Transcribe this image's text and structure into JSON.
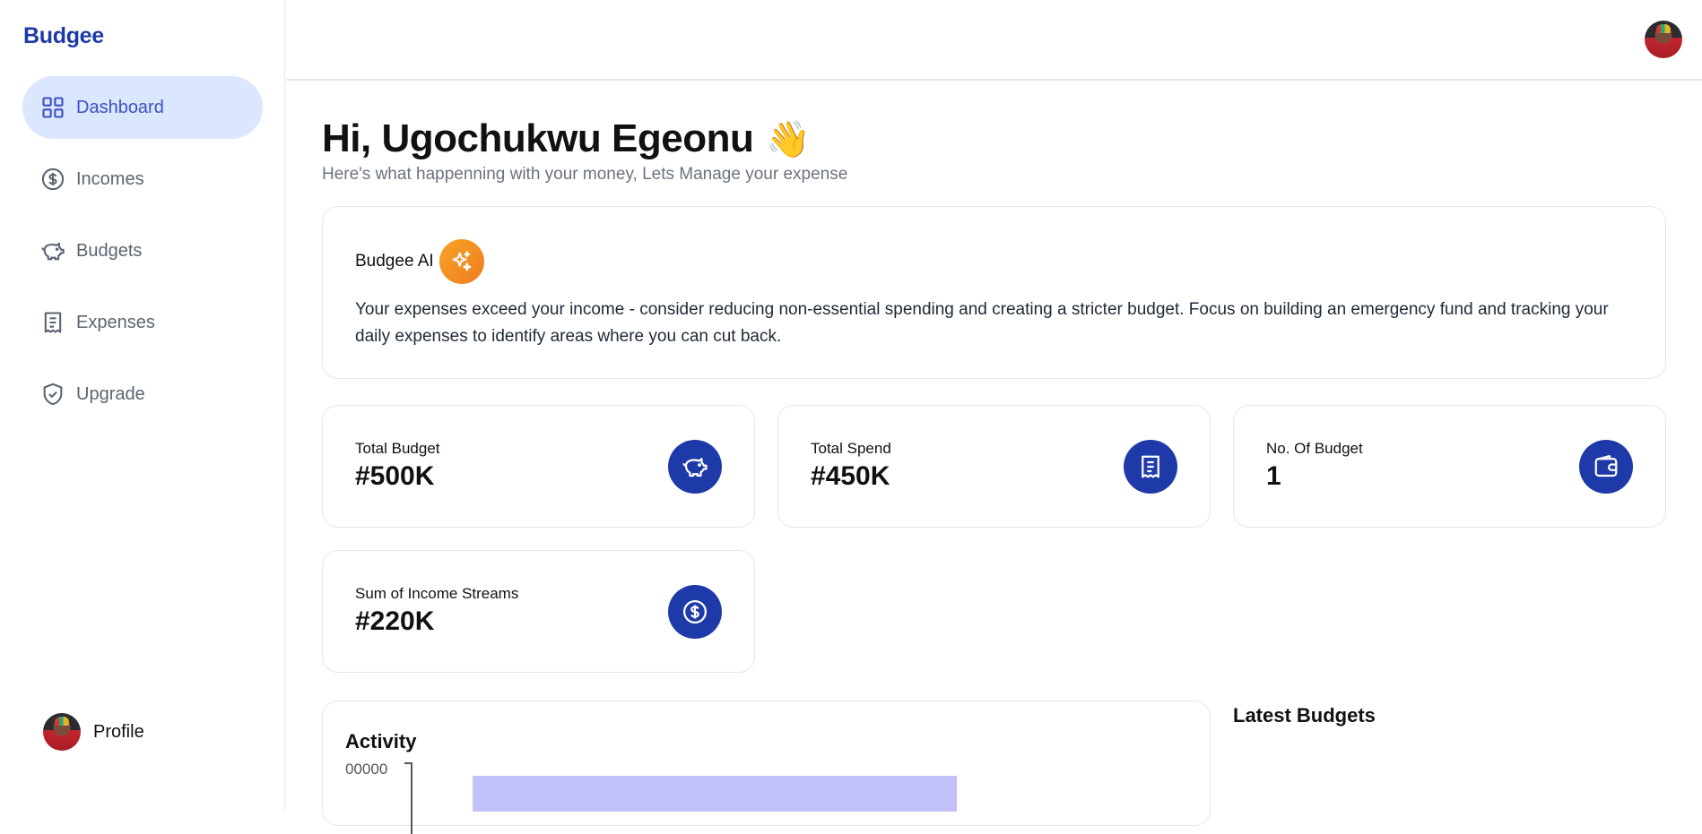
{
  "app": {
    "brand": "Budgee"
  },
  "sidebar": {
    "items": [
      {
        "label": "Dashboard",
        "icon": "grid-icon"
      },
      {
        "label": "Incomes",
        "icon": "dollar-circle-icon"
      },
      {
        "label": "Budgets",
        "icon": "piggy-bank-icon"
      },
      {
        "label": "Expenses",
        "icon": "receipt-icon"
      },
      {
        "label": "Upgrade",
        "icon": "shield-check-icon"
      }
    ],
    "profile_label": "Profile"
  },
  "header": {
    "greeting": "Hi, Ugochukwu Egeonu",
    "wave_emoji": "👋",
    "subtitle": "Here's what happenning with your money, Lets Manage your expense"
  },
  "ai": {
    "title": "Budgee AI",
    "message": "Your expenses exceed your income - consider reducing non-essential spending and creating a stricter budget. Focus on building an emergency fund and tracking your daily expenses to identify areas where you can cut back."
  },
  "stats": [
    {
      "label": "Total Budget",
      "value": "#500K",
      "icon": "piggy-bank-icon"
    },
    {
      "label": "Total Spend",
      "value": "#450K",
      "icon": "receipt-icon"
    },
    {
      "label": "No. Of Budget",
      "value": "1",
      "icon": "wallet-icon"
    },
    {
      "label": "Sum of Income Streams",
      "value": "#220K",
      "icon": "dollar-circle-icon"
    }
  ],
  "activity": {
    "title": "Activity",
    "tick_label": "00000"
  },
  "latest_budgets": {
    "title": "Latest Budgets"
  },
  "colors": {
    "brand": "#1e3aa8",
    "active_nav_bg": "#dbe7fe",
    "ai_badge": "#f28c22",
    "bar": "#c3c1fb"
  }
}
